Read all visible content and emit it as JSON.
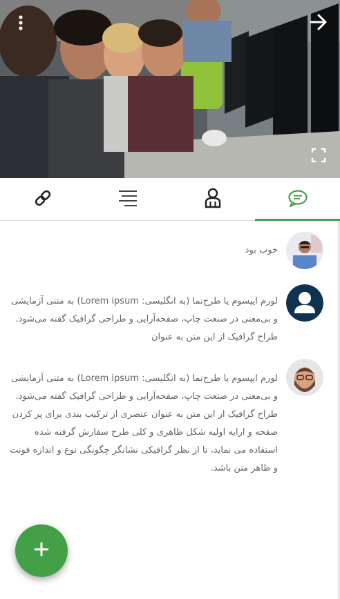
{
  "header": {
    "hero_image": "students-at-computers-photo",
    "icons": {
      "menu": "more-vert-icon",
      "back": "arrow-right-icon",
      "fullscreen": "fullscreen-icon"
    }
  },
  "tabs": [
    {
      "icon": "link-icon",
      "active": false
    },
    {
      "icon": "list-icon",
      "active": false
    },
    {
      "icon": "users-icon",
      "active": false
    },
    {
      "icon": "chat-icon",
      "active": true
    }
  ],
  "comments": [
    {
      "avatar": "man-blue-shirt-avatar",
      "text": "خوب بود"
    },
    {
      "avatar": "default-user-avatar",
      "text": "لورم ایپسوم یا طرح‌نما (به انگلیسی: Lorem ipsum) به متنی آزمایشی و بی‌معنی در صنعت چاپ، صفحه‌آرایی و طراحی گرافیک گفته می‌شود. طراح گرافیک از این متن به عنوان"
    },
    {
      "avatar": "bearded-man-avatar",
      "text": "لورم ایپسوم یا طرح‌نما (به انگلیسی: Lorem ipsum) به متنی آزمایشی و بی‌معنی در صنعت چاپ، صفحه‌آرایی و طراحی گرافیک گفته می‌شود. طراح گرافیک از این متن به عنوان عنصری از ترکیب بندی برای پر کردن صفحه و ارایه اولیه شکل ظاهری و کلی طرح سفارش گرفته شده استفاده می نماید، تا از نظر گرافیکی نشانگر چگونگی نوع و اندازه فونت و ظاهر متن باشد."
    }
  ],
  "fab": {
    "icon": "plus-icon"
  },
  "colors": {
    "accent": "#43a047",
    "text": "#666666",
    "divider": "#dcdcdc"
  }
}
